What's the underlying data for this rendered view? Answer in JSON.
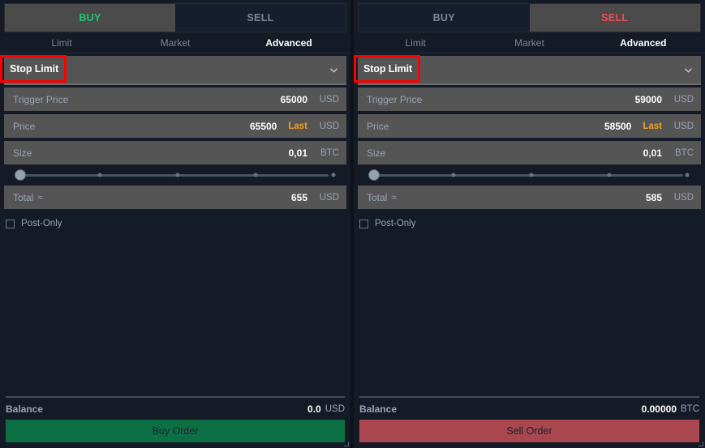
{
  "panels": [
    {
      "id": "buy-panel",
      "side_tabs": [
        {
          "label": "BUY",
          "active": true
        },
        {
          "label": "SELL",
          "active": false
        }
      ],
      "type_tabs": [
        {
          "label": "Limit",
          "active": false
        },
        {
          "label": "Market",
          "active": false
        },
        {
          "label": "Advanced",
          "active": true
        }
      ],
      "order_type": {
        "selected": "Stop Limit",
        "highlight_color": "#ff0000",
        "chevron_icon": "chevron-down-icon"
      },
      "fields": [
        {
          "label": "Trigger Price",
          "value": "65000",
          "unit": "USD",
          "last": ""
        },
        {
          "label": "Price",
          "value": "65500",
          "unit": "USD",
          "last": "Last"
        },
        {
          "label": "Size",
          "value": "0,01",
          "unit": "BTC",
          "last": ""
        }
      ],
      "slider": {
        "value_percent": 0,
        "ticks": [
          25,
          50,
          75,
          100
        ]
      },
      "total": {
        "label": "Total",
        "approx": "≈",
        "value": "655",
        "unit": "USD"
      },
      "post_only": {
        "label": "Post-Only",
        "checked": false
      },
      "balance": {
        "label": "Balance",
        "value": "0.0",
        "unit": "USD"
      },
      "submit": {
        "label": "Buy Order",
        "color": "#0d7044"
      }
    },
    {
      "id": "sell-panel",
      "side_tabs": [
        {
          "label": "BUY",
          "active": false
        },
        {
          "label": "SELL",
          "active": true
        }
      ],
      "type_tabs": [
        {
          "label": "Limit",
          "active": false
        },
        {
          "label": "Market",
          "active": false
        },
        {
          "label": "Advanced",
          "active": true
        }
      ],
      "order_type": {
        "selected": "Stop Limit",
        "highlight_color": "#ff0000",
        "chevron_icon": "chevron-down-icon"
      },
      "fields": [
        {
          "label": "Trigger Price",
          "value": "59000",
          "unit": "USD",
          "last": ""
        },
        {
          "label": "Price",
          "value": "58500",
          "unit": "USD",
          "last": "Last"
        },
        {
          "label": "Size",
          "value": "0,01",
          "unit": "BTC",
          "last": ""
        }
      ],
      "slider": {
        "value_percent": 0,
        "ticks": [
          25,
          50,
          75,
          100
        ]
      },
      "total": {
        "label": "Total",
        "approx": "≈",
        "value": "585",
        "unit": "USD"
      },
      "post_only": {
        "label": "Post-Only",
        "checked": false
      },
      "balance": {
        "label": "Balance",
        "value": "0.00000",
        "unit": "BTC"
      },
      "submit": {
        "label": "Sell Order",
        "color": "#a9464e"
      }
    }
  ],
  "theme": {
    "background": "#141a26",
    "field_background": "#555555",
    "buy_green": "#21c573",
    "sell_red": "#f04b57",
    "last_orange": "#f0a020",
    "muted_text": "#9aa3b4"
  }
}
